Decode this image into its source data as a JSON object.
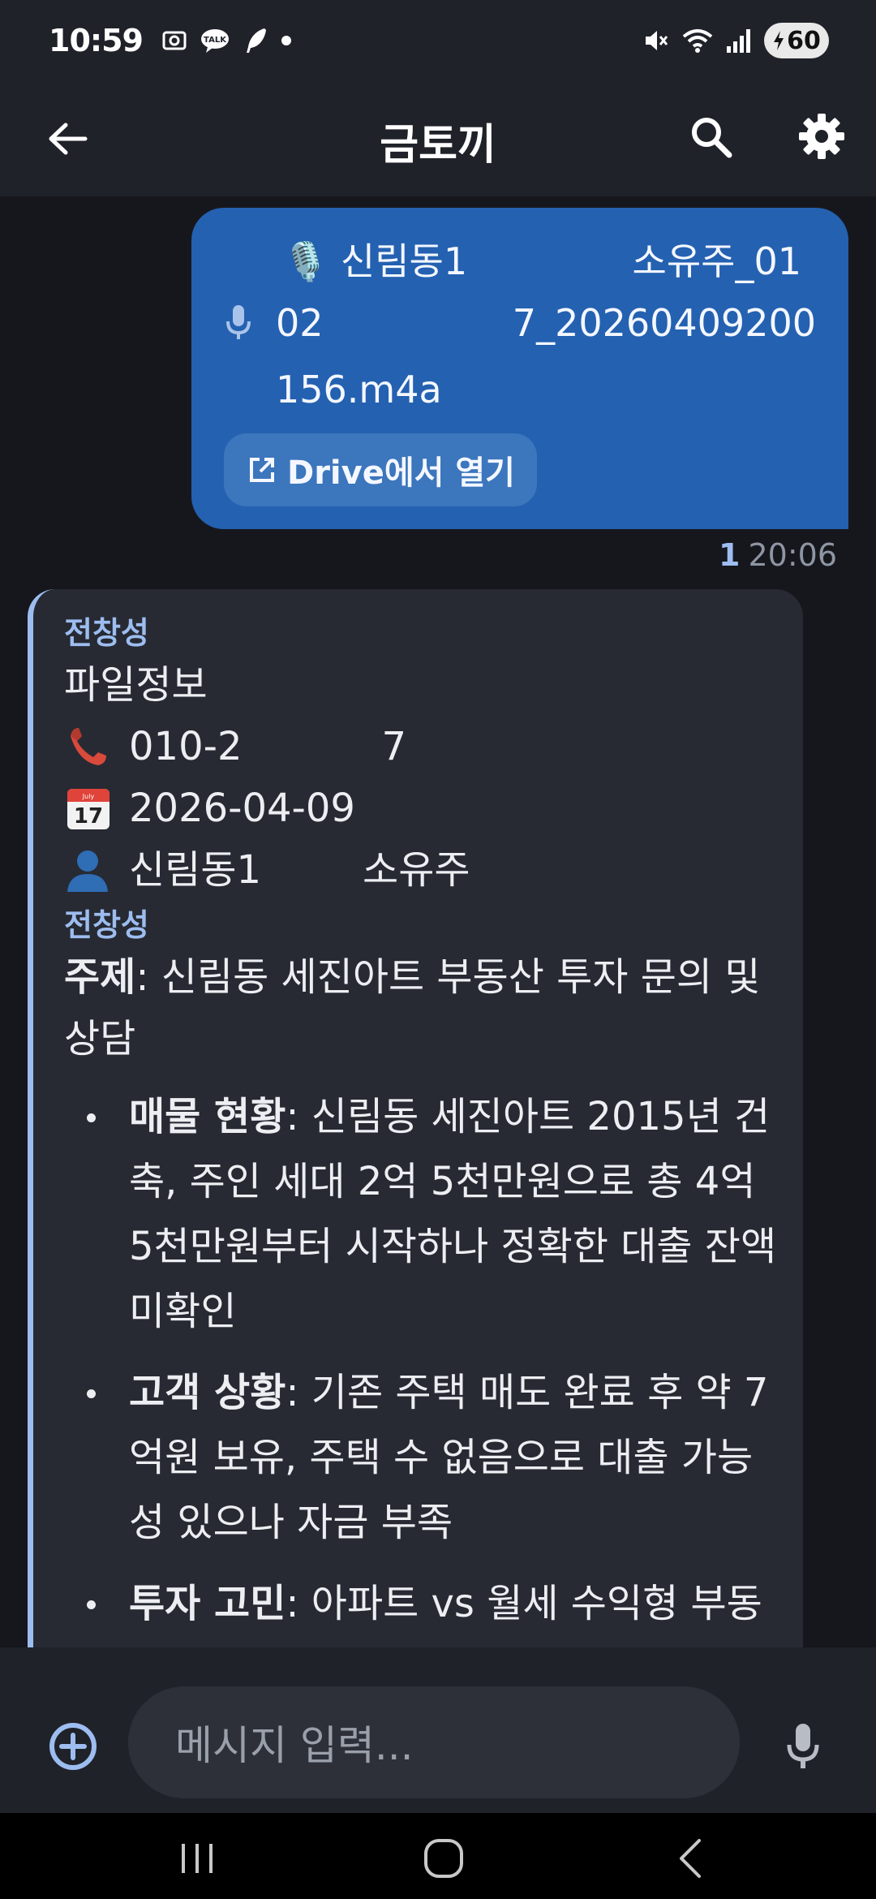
{
  "status_bar": {
    "time": "10:59",
    "left_icons": [
      "screenshot-icon",
      "talk-icon",
      "feather-icon",
      "dot-icon"
    ],
    "right_icons": [
      "mute-icon",
      "wifi-icon",
      "signal-icon"
    ],
    "battery_level": "60",
    "battery_charging": true
  },
  "app_bar": {
    "title": "금토끼",
    "back_icon": "arrow-back-icon",
    "search_icon": "search-icon",
    "settings_icon": "gear-icon"
  },
  "sent_message": {
    "file_prefix": "🎙️ 신림동1",
    "file_suffix": "소유주_01",
    "file_line2_left": "02",
    "file_line2_right": "7_20260409200",
    "file_line3": "156.m4a",
    "drive_button_label": "Drive에서 열기",
    "read_count": "1",
    "time": "20:06"
  },
  "received_message": {
    "sender": "전창성",
    "file_info_label": "파일정보",
    "phone_left": "010-2",
    "phone_right": "7",
    "date": "2026-04-09",
    "person_left": "신림동1",
    "person_right": "소유주",
    "sender2": "전창성",
    "topic_label": "주제",
    "topic_text": ": 신림동 세진아트 부동산 투자 문의 및 상담",
    "bullets": [
      {
        "label": "매물 현황",
        "text": ": 신림동 세진아트 2015년 건축, 주인 세대 2억 5천만원으로 총 4억 5천만원부터 시작하나 정확한 대출 잔액 미확인"
      },
      {
        "label": "고객 상황",
        "text": ": 기존 주택 매도 완료 후 약 7억원 보유, 주택 수 없음으로 대출 가능성 있으나 자금 부족"
      },
      {
        "label": "투자 고민",
        "text": ": 아파트 vs 월세 수익형 부동"
      }
    ]
  },
  "input_bar": {
    "placeholder": "메시지 입력..."
  },
  "nav_bar": {
    "buttons": [
      "recents-icon",
      "home-icon",
      "back-icon"
    ]
  }
}
